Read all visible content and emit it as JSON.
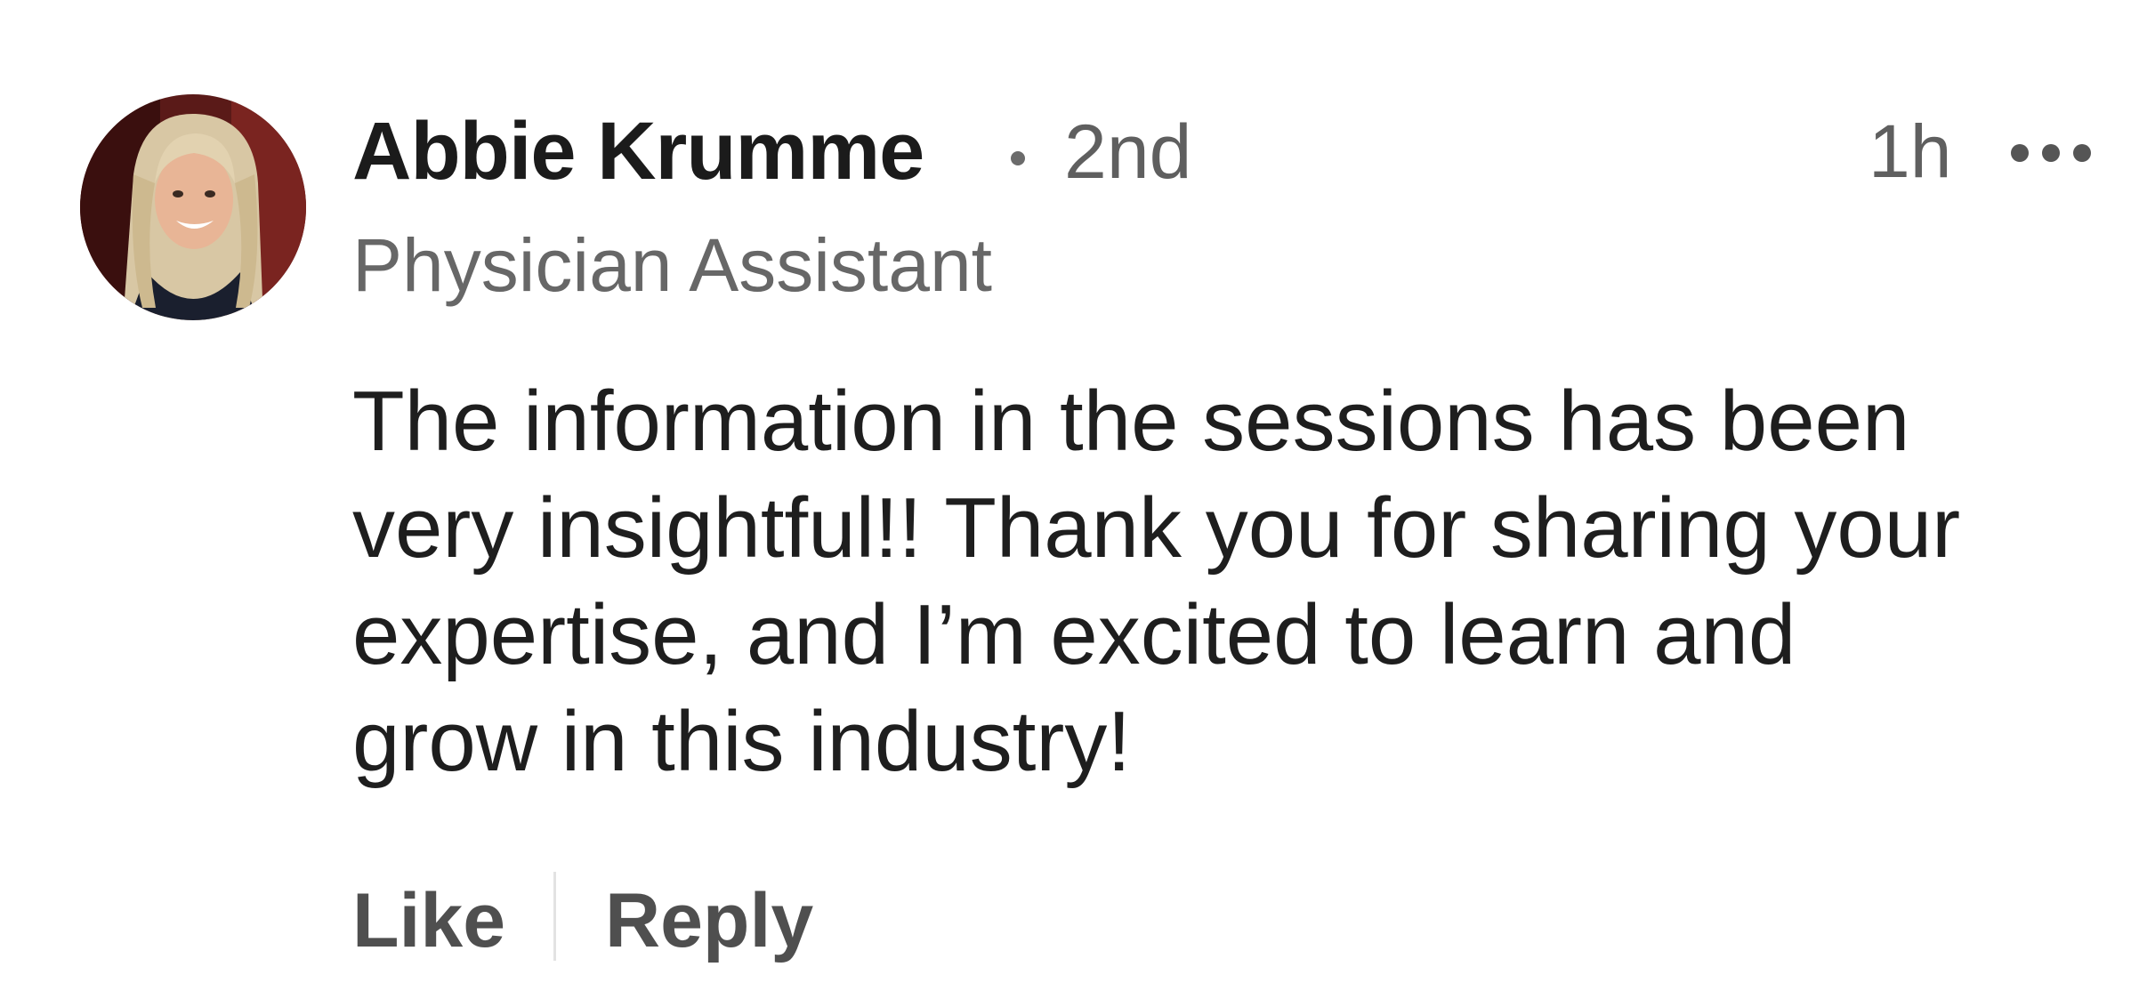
{
  "comment": {
    "author": {
      "name": "Abbie Krumme",
      "degree": "2nd",
      "headline": "Physician Assistant",
      "avatar_icon": "profile-photo"
    },
    "timestamp": "1h",
    "more_icon": "ellipsis-icon",
    "body_lines": [
      "The information in the sessions has been",
      "very insightful!! Thank you for sharing your",
      "expertise, and I’m excited to learn and",
      "grow in this industry!"
    ],
    "actions": {
      "like_label": "Like",
      "reply_label": "Reply"
    }
  },
  "colors": {
    "primary_text": "#1b1b1b",
    "secondary_text": "#5f5f5f",
    "action_text": "#4f4f4f",
    "divider": "#e3e3e3",
    "background": "#ffffff"
  }
}
